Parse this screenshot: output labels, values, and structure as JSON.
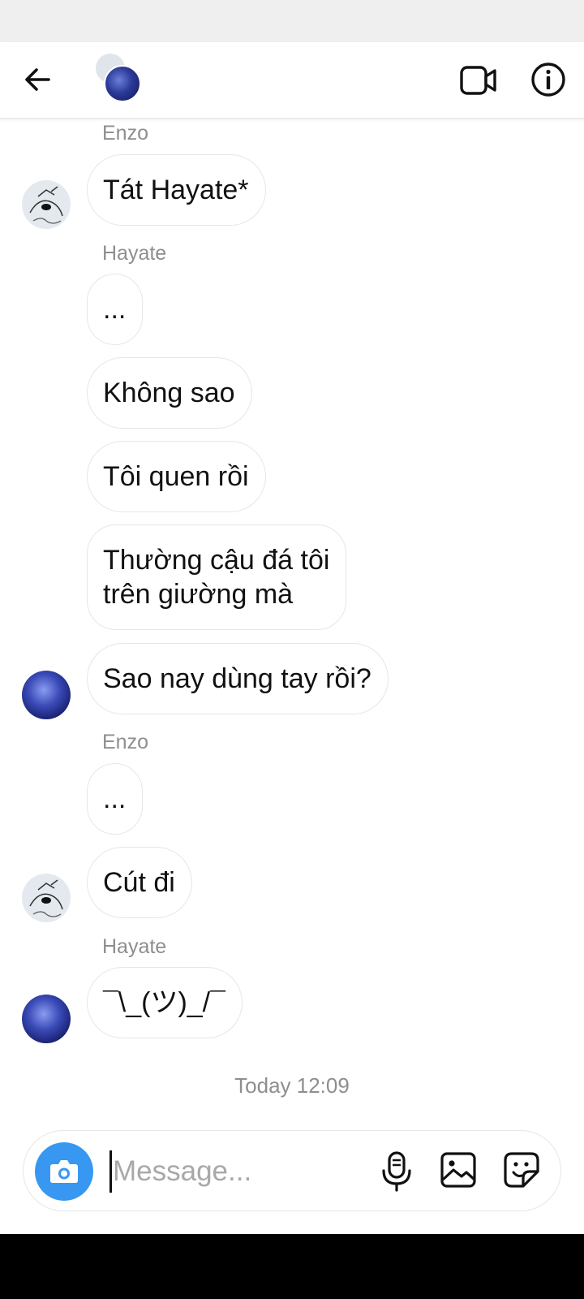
{
  "header": {
    "back_icon": "arrow-left-icon",
    "video_icon": "video-camera-icon",
    "info_icon": "info-icon"
  },
  "conversation": [
    {
      "sender": "Enzo",
      "messages": [
        "Tát Hayate*"
      ]
    },
    {
      "sender": "Hayate",
      "messages": [
        "...",
        "Không sao",
        "Tôi quen rồi",
        "Thường cậu đá tôi\ntrên giường mà",
        "Sao nay dùng tay rồi?"
      ]
    },
    {
      "sender": "Enzo",
      "messages": [
        "...",
        "Cút đi"
      ]
    },
    {
      "sender": "Hayate",
      "messages": [
        "¯\\_(ツ)_/¯"
      ]
    }
  ],
  "timestamp": "Today 12:09",
  "composer": {
    "placeholder": "Message...",
    "value": "",
    "camera_icon": "camera-icon",
    "mic_icon": "microphone-icon",
    "gallery_icon": "image-icon",
    "sticker_icon": "sticker-icon"
  },
  "colors": {
    "accent": "#3897f0",
    "bubble_border": "#e6e6e6",
    "meta_text": "#8e8e8e"
  }
}
